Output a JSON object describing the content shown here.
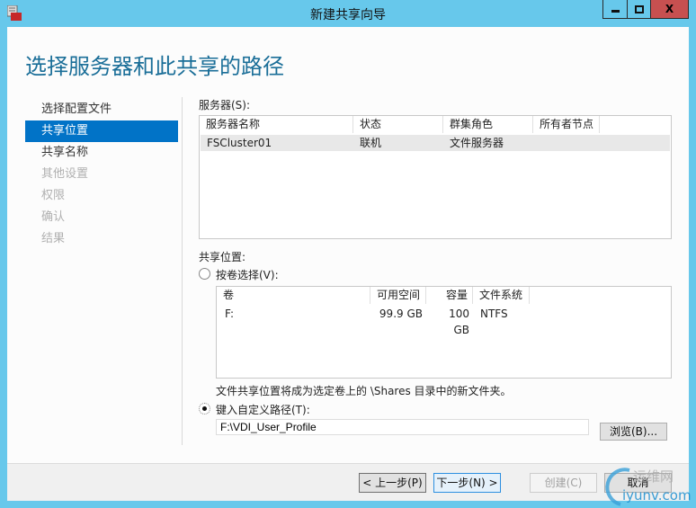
{
  "window": {
    "title": "新建共享向导",
    "minimize": "▁",
    "maximize": "□",
    "close": "X"
  },
  "heading": "选择服务器和此共享的路径",
  "nav": [
    {
      "label": "选择配置文件",
      "state": "normal"
    },
    {
      "label": "共享位置",
      "state": "selected"
    },
    {
      "label": "共享名称",
      "state": "normal"
    },
    {
      "label": "其他设置",
      "state": "disabled"
    },
    {
      "label": "权限",
      "state": "disabled"
    },
    {
      "label": "确认",
      "state": "disabled"
    },
    {
      "label": "结果",
      "state": "disabled"
    }
  ],
  "servers": {
    "label": "服务器(S):",
    "columns": [
      "服务器名称",
      "状态",
      "群集角色",
      "所有者节点"
    ],
    "rows": [
      [
        "FSCluster01",
        "联机",
        "文件服务器",
        ""
      ]
    ]
  },
  "share_location": {
    "label": "共享位置:",
    "by_volume": {
      "label": "按卷选择(V):",
      "selected": false
    },
    "volumes": {
      "columns": [
        "卷",
        "可用空间",
        "容量",
        "文件系统"
      ],
      "rows": [
        [
          "F:",
          "99.9 GB",
          "100 GB",
          "NTFS"
        ]
      ]
    },
    "note": "文件共享位置将成为选定卷上的 \\Shares 目录中的新文件夹。",
    "custom_path": {
      "label": "键入自定义路径(T):",
      "selected": true,
      "value": "F:\\VDI_User_Profile"
    },
    "browse": "浏览(B)..."
  },
  "footer": {
    "prev": "< 上一步(P)",
    "next": "下一步(N) >",
    "create": "创建(C)",
    "cancel": "取消"
  },
  "watermark": {
    "line1": "运维网",
    "line2": "iyunv.com"
  },
  "colors": {
    "accent": "#0173c7",
    "titlebar": "#67c8eb",
    "close": "#c75050",
    "heading": "#1a6e98"
  }
}
